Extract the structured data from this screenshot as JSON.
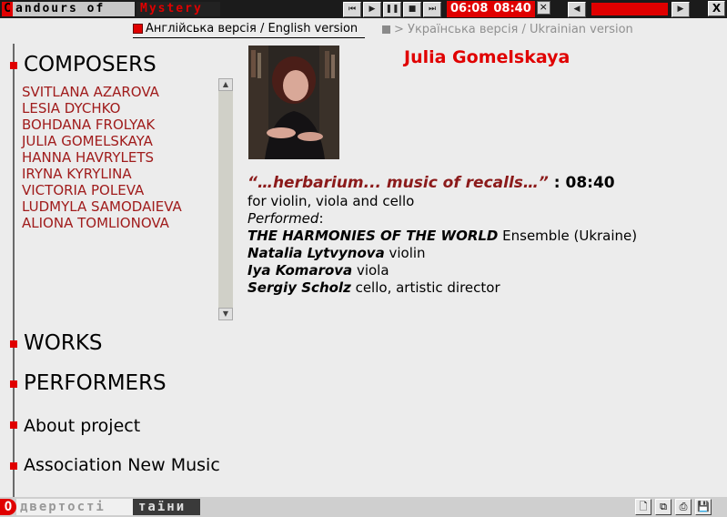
{
  "topbar": {
    "logo_initial": "C",
    "logo_rest": "andours of",
    "logo_alt": "Mystery",
    "player": {
      "btn_back_end": "⏮",
      "btn_play": "▶",
      "btn_pause": "❚❚",
      "btn_stop": "■",
      "btn_forward_end": "⏭",
      "time_elapsed": "06:08",
      "time_total": "08:40",
      "close_label": "×"
    },
    "volume": {
      "left_arrow": "◀",
      "right_arrow": "▶",
      "level": 1.0
    },
    "exit_label": "X"
  },
  "lang": {
    "english": "Англійська версія /  English version",
    "ukrainian": "> Українська версія /  Ukrainian version"
  },
  "nav": {
    "composers": "COMPOSERS",
    "works": "WORKS",
    "performers": "PERFORMERS",
    "about": "About project",
    "association": "Association New Music"
  },
  "composers_list": [
    "SVITLANA AZAROVA",
    "LESIA DYCHKO",
    "BOHDANA FROLYAK",
    "JULIA GOMELSKAYA",
    "HANNA HAVRYLETS",
    "IRYNA KYRYLINA",
    "VICTORIA POLEVA",
    "LUDMYLA SAMODAIEVA",
    "ALIONA TOMLIONOVA"
  ],
  "content": {
    "composer_name": "Julia Gomelskaya",
    "work_title": "“…herbarium... music of recalls…”",
    "work_duration": ": 08:40",
    "instrumentation": "for violin, viola and cello",
    "performed_label": "Performed",
    "performed_colon": ":",
    "ensemble_name": "THE HARMONIES OF THE WORLD",
    "ensemble_desc": " Ensemble (Ukraine)",
    "performers": [
      {
        "name": "Natalia Lytvynova",
        "role": " violin"
      },
      {
        "name": "Iya Komarova",
        "role": " viola"
      },
      {
        "name": "Sergiy Scholz",
        "role": " cello, artistic director"
      }
    ]
  },
  "bottombar": {
    "logo_initial": "O",
    "logo_rest": "двертості",
    "logo_alt": "таїни",
    "tools": [
      "🗋",
      "⧉",
      "⎙",
      "💾"
    ]
  }
}
